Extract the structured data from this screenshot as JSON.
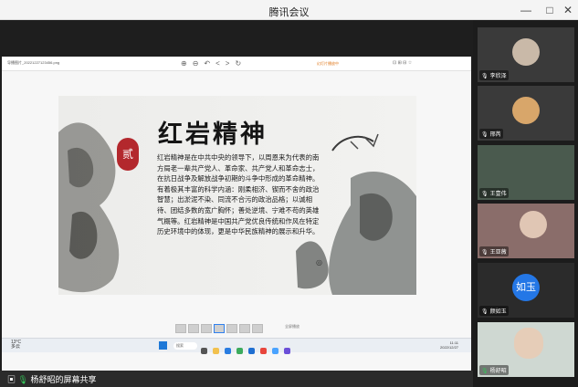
{
  "window": {
    "title": "腾讯会议",
    "minimize": "—",
    "maximize": "□",
    "close": "✕"
  },
  "viewer": {
    "filename": "导播图片_20221227123456.png",
    "toolbar_icons": "⊕⊖↶<>↻",
    "notice": "幻灯片播放中",
    "right_tools": "⊡ ⊞ ⊟ ☆"
  },
  "slide": {
    "title": "红岩精神",
    "seal": "贰",
    "body": "红岩精神是在中共中央的领导下，以周恩来为代表的南方局老一辈共产党人、革命家、共产党人和革命志士，在抗日战争及解放战争初期的斗争中形成的革命精神。有着极其丰富的科学内涵：刚柔相济、锲而不舍的政治智慧；出淤泥不染、同流不合污的政治品格；以诚相待、团结多数的宽广胸怀；善处逆境、宁难不苟的英雄气概等。红岩精神是中国共产党优良传统和作风在特定历史环境中的体现，更是中华民族精神的展示和升华。"
  },
  "thumbnails": {
    "label": "全屏播放"
  },
  "taskbar": {
    "weather_top": "13°C",
    "weather_bottom": "多云",
    "search": "搜索",
    "clock_time": "11:11",
    "clock_date": "2022/12/27"
  },
  "participants": [
    {
      "name": "李欣泽"
    },
    {
      "name": "邢芮"
    },
    {
      "name": "王壹伟"
    },
    {
      "name": "王亚薇"
    },
    {
      "name": "颜如玉",
      "avatar_text": "如玉"
    },
    {
      "name": "杨舒昭"
    }
  ],
  "bottom": {
    "share_label": "杨舒昭的屏幕共享"
  },
  "colors": {
    "seal": "#b3282d",
    "avatar_blue": "#2477e6"
  }
}
